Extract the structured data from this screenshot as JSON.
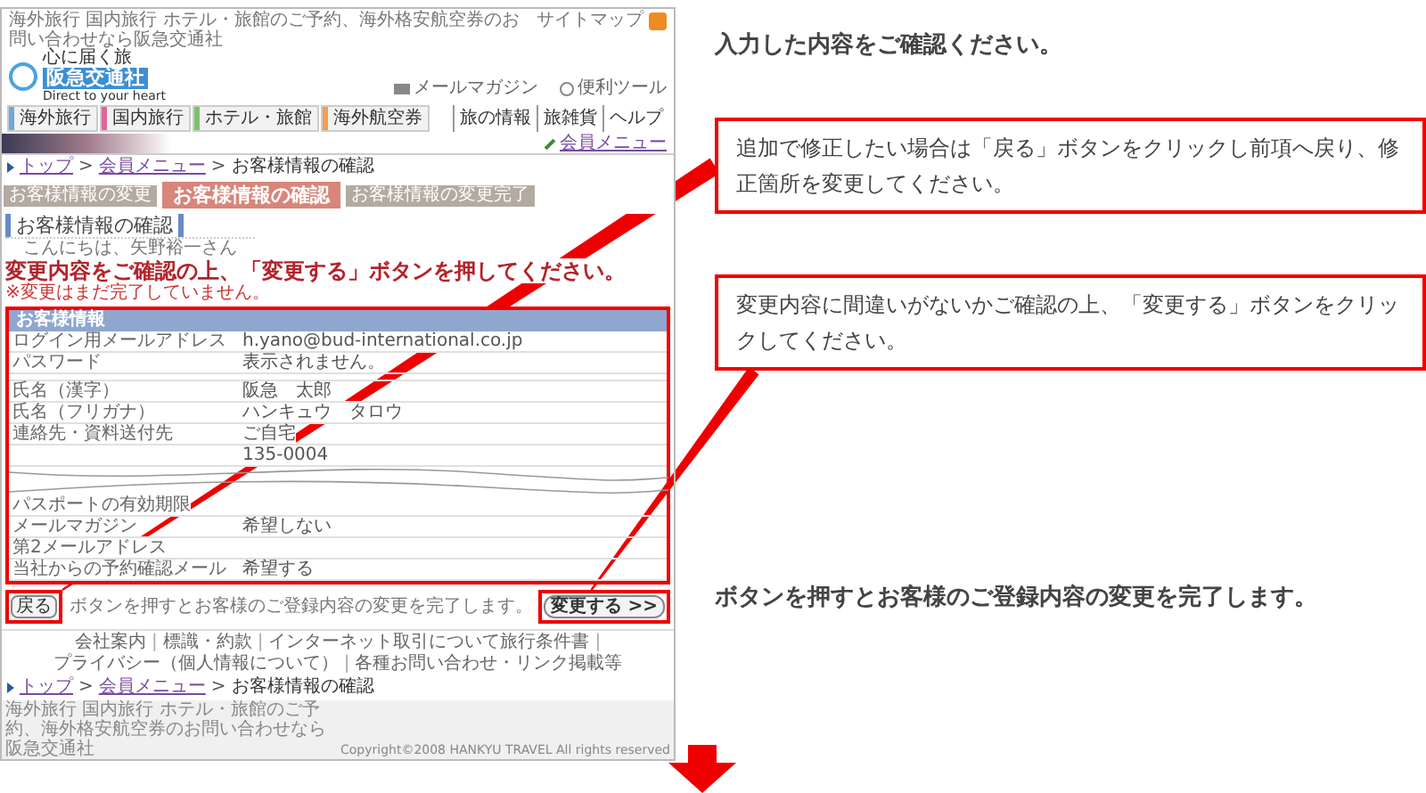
{
  "site": {
    "tagline": "海外旅行 国内旅行 ホテル・旅館のご予約、海外格安航空券のお問い合わせなら阪急交通社",
    "sitemap": "サイトマップ",
    "logo_catch": "心に届く旅",
    "logo_name": "阪急交通社",
    "logo_slogan": "Direct to your heart",
    "utility_links": [
      "メールマガジン",
      "便利ツール"
    ],
    "nav_tabs": [
      {
        "label": "海外旅行",
        "color": "#6fa8dc"
      },
      {
        "label": "国内旅行",
        "color": "#e06699"
      },
      {
        "label": "ホテル・旅館",
        "color": "#7cc26a"
      },
      {
        "label": "海外航空券",
        "color": "#f0a04b"
      }
    ],
    "sub_nav": [
      "旅の情報",
      "旅雑貨",
      "ヘルプ"
    ],
    "member_menu": "会員メニュー"
  },
  "breadcrumb": [
    {
      "kind": "link",
      "label": "トップ"
    },
    {
      "kind": "sep",
      "label": ">"
    },
    {
      "kind": "link",
      "label": "会員メニュー"
    },
    {
      "kind": "sep",
      "label": ">"
    },
    {
      "kind": "current",
      "label": "お客様情報の確認"
    }
  ],
  "steps": [
    {
      "label": "お客様情報の変更",
      "selected": false
    },
    {
      "label": "お客様情報の確認",
      "selected": true
    },
    {
      "label": "お客様情報の変更完了",
      "selected": false
    }
  ],
  "section_title": "お客様情報の確認",
  "greeting": "こんにちは、矢野裕一さん",
  "headline": "変更内容をご確認の上、「変更する」ボタンを押してください。",
  "note": "※変更はまだ完了していません。",
  "table": {
    "header": "お客様情報",
    "rows": [
      {
        "kind": "row",
        "label": "ログイン用メールアドレス",
        "value": "h.yano@bud-international.co.jp"
      },
      {
        "kind": "row",
        "label": "パスワード",
        "value": "表示されません。"
      },
      {
        "kind": "gap"
      },
      {
        "kind": "row",
        "label": "氏名（漢字）",
        "value": "阪急　太郎"
      },
      {
        "kind": "row",
        "label": "氏名（フリガナ）",
        "value": "ハンキュウ　タロウ"
      },
      {
        "kind": "row",
        "label": "連絡先・資料送付先",
        "value": "ご自宅"
      },
      {
        "kind": "row",
        "value": "135-0004"
      },
      {
        "kind": "break"
      },
      {
        "kind": "row",
        "label": "パスポートの有効期限"
      },
      {
        "kind": "row",
        "label": "メールマガジン",
        "value": "希望しない"
      },
      {
        "kind": "row",
        "label": "第2メールアドレス"
      },
      {
        "kind": "row",
        "label": "当社からの予約確認メール",
        "value": "希望する"
      }
    ]
  },
  "back_button": "戻る",
  "submit_note": "ボタンを押すとお客様のご登録内容の変更を完了します。",
  "submit_button": "変更する >>",
  "footer_links": [
    {
      "kind": "link",
      "label": "会社案内"
    },
    {
      "kind": "sep",
      "label": "|"
    },
    {
      "kind": "link",
      "label": "標識・約款"
    },
    {
      "kind": "sep",
      "label": "|"
    },
    {
      "kind": "link",
      "label": "インターネット取引について旅行条件書"
    },
    {
      "kind": "sep",
      "label": "|"
    },
    {
      "kind": "link",
      "label": "プライバシー（個人情報について）"
    },
    {
      "kind": "sep",
      "label": "|"
    },
    {
      "kind": "link",
      "label": "各種お問い合わせ・リンク掲載等"
    }
  ],
  "footer_breadcrumb": [
    {
      "kind": "link",
      "label": "トップ"
    },
    {
      "kind": "sep",
      "label": ">"
    },
    {
      "kind": "link",
      "label": "会員メニュー"
    },
    {
      "kind": "sep",
      "label": ">"
    },
    {
      "kind": "current",
      "label": "お客様情報の確認"
    }
  ],
  "footer_tagline": "海外旅行 国内旅行 ホテル・旅館のご予約、海外格安航空券のお問い合わせなら阪急交通社",
  "copyright": "Copyright©2008 HANKYU TRAVEL All rights reserved",
  "annotations": [
    {
      "kind": "plain",
      "text": "入力した内容をご確認ください。"
    },
    {
      "kind": "callout",
      "text": "追加で修正したい場合は「戻る」ボタンをクリックし前項へ戻り、修正箇所を変更してください。"
    },
    {
      "kind": "callout",
      "text": "変更内容に間違いがないかご確認の上、「変更する」ボタンをクリックしてください。"
    },
    {
      "kind": "plain",
      "text": "ボタンを押すとお客様のご登録内容の変更を完了します。"
    }
  ]
}
